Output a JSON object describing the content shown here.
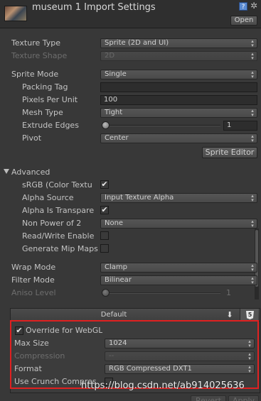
{
  "header": {
    "title": "museum 1 Import Settings",
    "help_glyph": "?",
    "gear_glyph": "✲",
    "open_label": "Open"
  },
  "texture_type": {
    "label": "Texture Type",
    "value": "Sprite (2D and UI)"
  },
  "texture_shape": {
    "label": "Texture Shape",
    "value": "2D"
  },
  "sprite_mode": {
    "label": "Sprite Mode",
    "value": "Single"
  },
  "packing_tag": {
    "label": "Packing Tag",
    "value": ""
  },
  "pixels_per_unit": {
    "label": "Pixels Per Unit",
    "value": "100"
  },
  "mesh_type": {
    "label": "Mesh Type",
    "value": "Tight"
  },
  "extrude_edges": {
    "label": "Extrude Edges",
    "value": "1",
    "level": 0.0
  },
  "pivot": {
    "label": "Pivot",
    "value": "Center"
  },
  "sprite_editor_label": "Sprite Editor",
  "advanced": {
    "label": "Advanced",
    "srgb": {
      "label": "sRGB (Color Textu",
      "checked": true
    },
    "alpha_source": {
      "label": "Alpha Source",
      "value": "Input Texture Alpha"
    },
    "alpha_is_transparency": {
      "label": "Alpha Is Transpare",
      "checked": true
    },
    "non_power_of_2": {
      "label": "Non Power of 2",
      "value": "None"
    },
    "read_write": {
      "label": "Read/Write Enable",
      "checked": false
    },
    "generate_mip_maps": {
      "label": "Generate Mip Maps",
      "checked": false
    }
  },
  "wrap_mode": {
    "label": "Wrap Mode",
    "value": "Clamp"
  },
  "filter_mode": {
    "label": "Filter Mode",
    "value": "Bilinear"
  },
  "aniso_level": {
    "label": "Aniso Level",
    "value": "1",
    "level": 0.0
  },
  "platform": {
    "default_tab": "Default",
    "download_glyph": "⬇",
    "html5_glyph": "5",
    "override": {
      "label": "Override for WebGL",
      "checked": true
    },
    "max_size": {
      "label": "Max Size",
      "value": "1024"
    },
    "compression": {
      "label": "Compression",
      "value": "--"
    },
    "format": {
      "label": "Format",
      "value": "RGB Compressed DXT1"
    },
    "use_crunch": {
      "label": "Use Crunch Compres",
      "checked": false
    }
  },
  "footer": {
    "revert_label": "Revert",
    "apply_label": "Apply"
  },
  "watermark": "https://blog.csdn.net/ab914025636",
  "colors": {
    "highlight_border": "#e02020",
    "background": "#383838"
  }
}
